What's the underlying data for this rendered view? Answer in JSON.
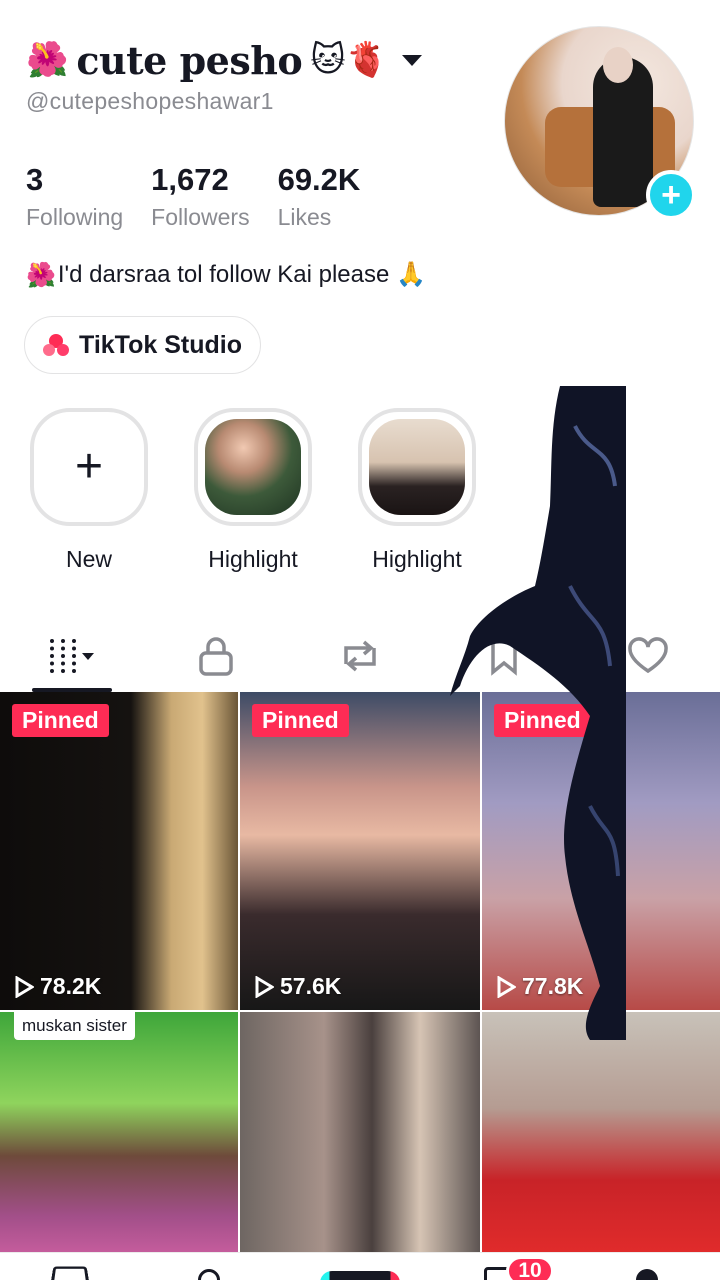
{
  "profile": {
    "flower_emoji": "🌺",
    "display_name": "cute pesho",
    "name_emojis": "🐱🫀",
    "username": "@cutepeshopeshawar1",
    "bio_emoji": "🌺",
    "bio": "I'd darsraa tol follow Kai please 🙏"
  },
  "stats": {
    "following_value": "3",
    "following_label": "Following",
    "followers_value": "1,672",
    "followers_label": "Followers",
    "likes_value": "69.2K",
    "likes_label": "Likes"
  },
  "avatar_add_label": "+",
  "studio": {
    "label": "TikTok Studio"
  },
  "highlights": [
    {
      "label": "New",
      "icon": "+"
    },
    {
      "label": "Highlight"
    },
    {
      "label": "Highlight"
    }
  ],
  "tabs": [
    {
      "name": "videos-grid-icon"
    },
    {
      "name": "lock-icon"
    },
    {
      "name": "repost-icon"
    },
    {
      "name": "bookmark-icon"
    },
    {
      "name": "heart-icon"
    }
  ],
  "videos": [
    {
      "badge": "Pinned",
      "views": "78.2K"
    },
    {
      "badge": "Pinned",
      "views": "57.6K"
    },
    {
      "badge": "Pinned",
      "views": "77.8K"
    },
    {
      "caption": "muskan sister"
    },
    {},
    {}
  ],
  "nav": {
    "inbox_badge": "10"
  },
  "colors": {
    "accent": "#fe2c55",
    "cyan": "#20d5ec",
    "text": "#161823",
    "muted": "#8a8b91"
  }
}
